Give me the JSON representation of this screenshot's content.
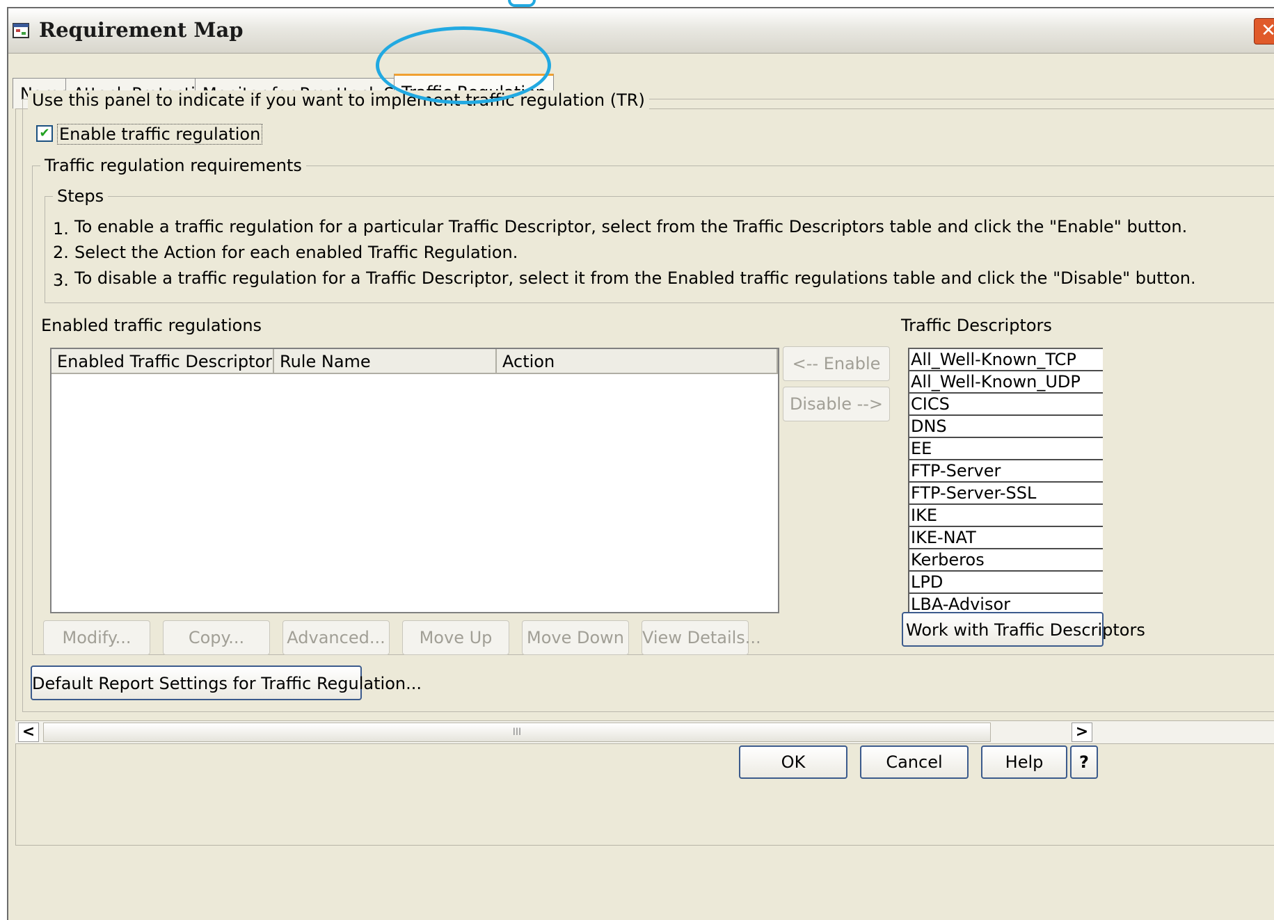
{
  "window": {
    "title": "Requirement Map",
    "close_glyph": "✕"
  },
  "tabs": [
    {
      "label": "Name"
    },
    {
      "label": "Attack Protection"
    },
    {
      "label": "Monitor for Preattack Scans"
    },
    {
      "label": "Traffic Regulation",
      "active": true
    }
  ],
  "panel": {
    "legend": "Use this panel to indicate if you want to implement traffic regulation (TR)",
    "enable_checkbox": {
      "label": "Enable traffic regulation",
      "checked": true,
      "check_glyph": "✔"
    },
    "requirements_legend": "Traffic regulation requirements",
    "steps": {
      "legend": "Steps",
      "items": [
        {
          "num": "1.",
          "text": "To enable a traffic regulation for a particular Traffic Descriptor, select from the Traffic Descriptors table and click the \"Enable\" button."
        },
        {
          "num": "2.",
          "text": "Select the Action for each enabled Traffic Regulation."
        },
        {
          "num": "3.",
          "text": "To disable a traffic regulation for a Traffic Descriptor, select it from the Enabled traffic regulations table and click the \"Disable\" button."
        }
      ]
    },
    "enabled_regulations": {
      "label": "Enabled traffic regulations",
      "columns": [
        "Enabled Traffic Descriptor",
        "Rule Name",
        "Action"
      ]
    },
    "enable_button": "<-- Enable",
    "disable_button": "Disable -->",
    "traffic_descriptors": {
      "label": "Traffic Descriptors",
      "items": [
        "All_Well-Known_TCP",
        "All_Well-Known_UDP",
        "CICS",
        "DNS",
        "EE",
        "FTP-Server",
        "FTP-Server-SSL",
        "IKE",
        "IKE-NAT",
        "Kerberos",
        "LPD",
        "LBA-Advisor"
      ],
      "work_button": "Work with Traffic Descriptors"
    },
    "action_buttons": [
      "Modify...",
      "Copy...",
      "Advanced...",
      "Move Up",
      "Move Down",
      "View Details..."
    ],
    "report_button": "Default Report Settings for Traffic Regulation..."
  },
  "scrollbar": {
    "left": "<",
    "right": ">",
    "grip": "III"
  },
  "footer": {
    "ok": "OK",
    "cancel": "Cancel",
    "help": "Help",
    "question": "?"
  },
  "colors": {
    "highlight": "#22a9e1",
    "active_tab_accent": "#f0a030",
    "dialog_bg": "#ece9d8"
  }
}
